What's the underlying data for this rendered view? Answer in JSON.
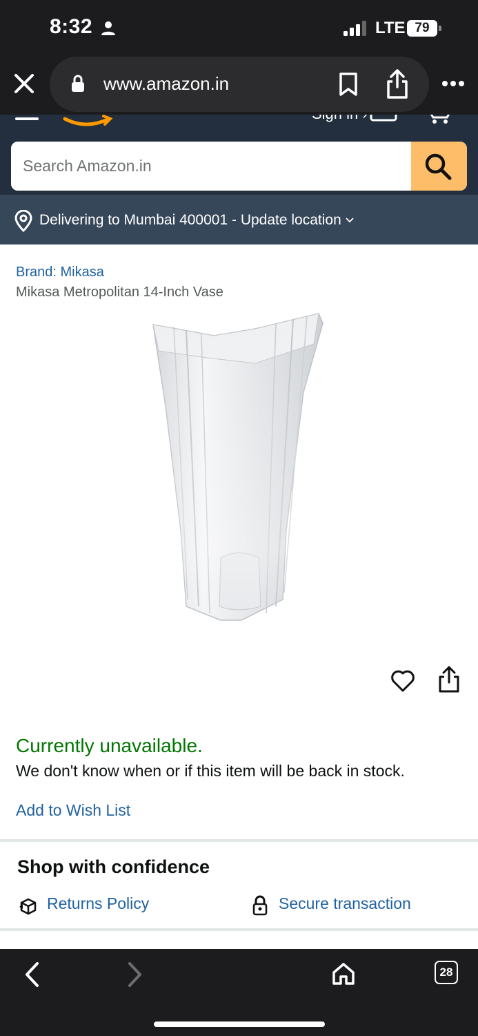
{
  "status_bar": {
    "time": "8:32",
    "network": "LTE",
    "battery": "79"
  },
  "browser": {
    "url": "www.amazon.in",
    "tab_count": "28"
  },
  "header": {
    "signin_partial": "Sign in ›",
    "search_placeholder": "Search Amazon.in",
    "location_text": "Delivering to Mumbai 400001 - Update location"
  },
  "product": {
    "brand": "Brand: Mikasa",
    "title": "Mikasa Metropolitan 14-Inch Vase",
    "availability": "Currently unavailable.",
    "stock_message": "We don't know when or if this item will be back in stock.",
    "add_to_wishlist": "Add to Wish List"
  },
  "confidence": {
    "heading": "Shop with confidence",
    "returns": "Returns Policy",
    "secure": "Secure transaction"
  },
  "colors": {
    "header_bg": "#232f3e",
    "location_bg": "#37475a",
    "search_button": "#febd69",
    "link": "#2162a1",
    "availability": "#007600"
  },
  "icons": [
    "person-icon",
    "signal-icon",
    "battery-icon",
    "close-icon",
    "lock-icon",
    "bookmark-icon",
    "share-icon",
    "more-icon",
    "search-icon",
    "location-pin-icon",
    "chevron-down-icon",
    "heart-icon",
    "returns-box-icon",
    "padlock-icon",
    "back-arrow-icon",
    "forward-arrow-icon",
    "home-icon",
    "tabs-icon"
  ]
}
